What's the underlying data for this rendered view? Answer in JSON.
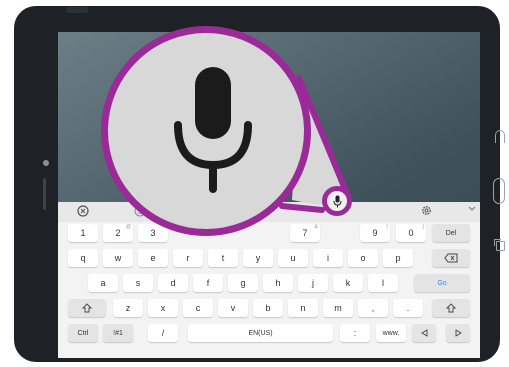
{
  "colors": {
    "highlight": "#9a2a98",
    "device": "#1e2226",
    "keyboard": "#f3f3f3",
    "go_key": "#2d8ff0"
  },
  "toolbar": {
    "icons": [
      "translate-icon",
      "emoji-icon",
      "microphone-icon",
      "settings-icon",
      "collapse-icon"
    ]
  },
  "keyboard": {
    "row1": [
      {
        "label": "1",
        "hint": "`"
      },
      {
        "label": "2",
        "hint": "@"
      },
      {
        "label": "3",
        "hint": "#"
      },
      {
        "label": "7",
        "hint": "&"
      },
      {
        "label": "9",
        "hint": "("
      },
      {
        "label": "0",
        "hint": ")"
      },
      {
        "label": "Del",
        "hint": ""
      }
    ],
    "row2": [
      "q",
      "w",
      "e",
      "r",
      "t",
      "y",
      "u",
      "i",
      "o",
      "p"
    ],
    "row3": [
      "a",
      "s",
      "d",
      "f",
      "g",
      "h",
      "j",
      "k",
      "l"
    ],
    "go": "Go",
    "row4": [
      "z",
      "x",
      "c",
      "v",
      "b",
      "n",
      "m"
    ],
    "row4_punct": [
      ",",
      "."
    ],
    "row5": {
      "ctrl": "Ctrl",
      "symbols": "!#1",
      "slash": "/",
      "space": "EN(US)",
      "colon": ":",
      "www": "www."
    }
  }
}
